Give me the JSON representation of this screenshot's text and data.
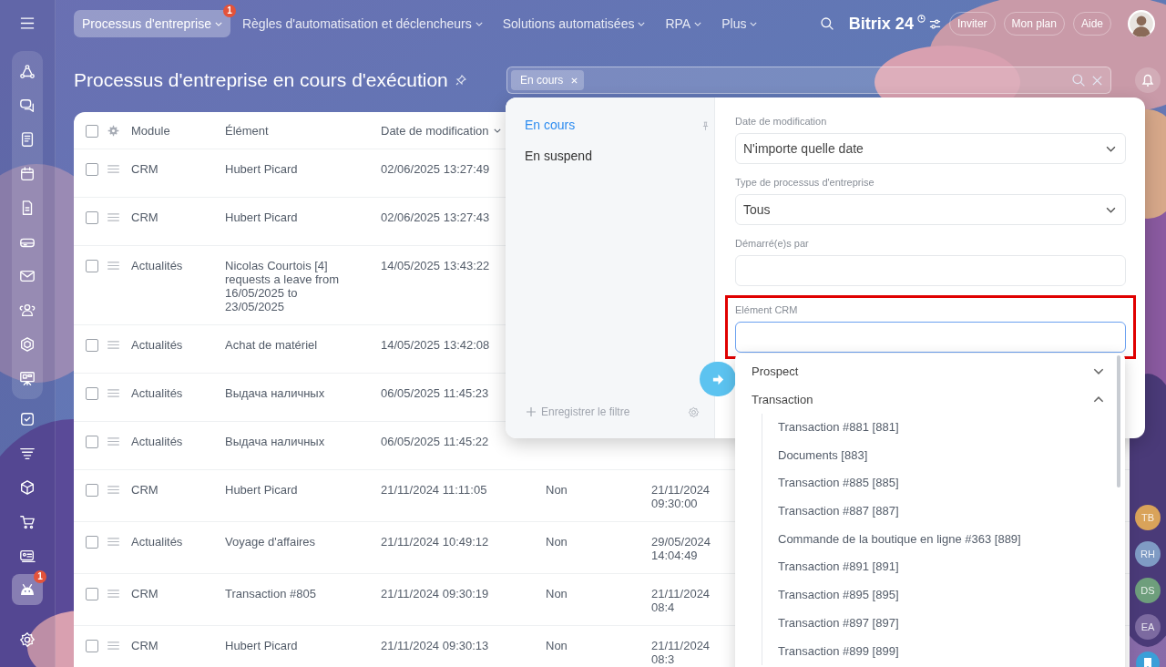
{
  "top_nav": {
    "tabs": [
      {
        "label": "Processus d'entreprise",
        "selected": true,
        "badge": "1"
      },
      {
        "label": "Règles d'automatisation et déclencheurs",
        "selected": false
      },
      {
        "label": "Solutions automatisées",
        "selected": false
      },
      {
        "label": "RPA",
        "selected": false
      },
      {
        "label": "Plus",
        "selected": false
      }
    ],
    "logo": "Bitrix 24",
    "buttons": [
      "Inviter",
      "Mon plan",
      "Aide"
    ]
  },
  "sidebar": {
    "pinned": [
      {
        "kind": "flow",
        "selected": false
      },
      {
        "kind": "chat",
        "selected": false
      },
      {
        "kind": "news",
        "selected": false
      },
      {
        "kind": "calendar",
        "selected": false
      },
      {
        "kind": "document",
        "selected": false
      },
      {
        "kind": "drive",
        "selected": false
      },
      {
        "kind": "mail",
        "selected": false
      },
      {
        "kind": "contacts",
        "selected": false
      },
      {
        "kind": "hexagon",
        "selected": false
      },
      {
        "kind": "board",
        "selected": false
      }
    ],
    "items": [
      {
        "kind": "task",
        "selected": false
      },
      {
        "kind": "funnel",
        "selected": false
      },
      {
        "kind": "box",
        "selected": false
      },
      {
        "kind": "cart",
        "selected": false
      },
      {
        "kind": "card",
        "selected": false
      },
      {
        "kind": "robot",
        "selected": true,
        "badge": "1"
      }
    ]
  },
  "page": {
    "title": "Processus d'entreprise en cours d'exécution"
  },
  "filter_bar": {
    "chips": [
      "En cours"
    ]
  },
  "table": {
    "all_checked": false,
    "columns": [
      "Module",
      "Élément",
      "Date de modification"
    ],
    "rows": [
      {
        "checked": false,
        "module": "CRM",
        "element": "Hubert Picard",
        "date": "02/06/2025 13:27:49"
      },
      {
        "checked": false,
        "module": "CRM",
        "element": "Hubert Picard",
        "date": "02/06/2025 13:27:43"
      },
      {
        "checked": false,
        "module": "Actualités",
        "element": "Nicolas Courtois [4] requests a leave from 16/05/2025 to 23/05/2025",
        "date": "14/05/2025 13:43:22"
      },
      {
        "checked": false,
        "module": "Actualités",
        "element": "Achat de matériel",
        "date": "14/05/2025 13:42:08"
      },
      {
        "checked": false,
        "module": "Actualités",
        "element": "Выдача наличных",
        "date": "06/05/2025 11:45:23"
      },
      {
        "checked": false,
        "module": "Actualités",
        "element": "Выдача наличных",
        "date": "06/05/2025 11:45:22"
      },
      {
        "checked": false,
        "module": "CRM",
        "element": "Hubert Picard",
        "date": "21/11/2024 11:11:05",
        "column_4": "Non",
        "column_5": "21/11/2024 09:30:00"
      },
      {
        "checked": false,
        "module": "Actualités",
        "element": "Voyage d'affaires",
        "date": "21/11/2024 10:49:12",
        "column_4": "Non",
        "column_5": "29/05/2024 14:04:49"
      },
      {
        "checked": false,
        "module": "CRM",
        "element": "Transaction #805",
        "date": "21/11/2024 09:30:19",
        "column_4": "Non",
        "column_5": "21/11/2024 08:4"
      },
      {
        "checked": false,
        "module": "CRM",
        "element": "Hubert Picard",
        "date": "21/11/2024 09:30:13",
        "column_4": "Non",
        "column_5": "21/11/2024 08:3"
      }
    ]
  },
  "filter_popup": {
    "presets": [
      {
        "label": "En cours",
        "selected": true
      },
      {
        "label": "En suspend",
        "selected": false
      }
    ],
    "save_label": "Enregistrer le filtre",
    "fields": [
      {
        "label": "Date de modification",
        "kind": "select",
        "value": "N'importe quelle date",
        "focused": false,
        "highlighted": false
      },
      {
        "label": "Type de processus d'entreprise",
        "kind": "select",
        "value": "Tous",
        "focused": false,
        "highlighted": false
      },
      {
        "label": "Démarré(e)s par",
        "kind": "input",
        "focused": false,
        "highlighted": false
      },
      {
        "label": "Elément CRM",
        "kind": "input",
        "focused": true,
        "highlighted": true
      }
    ]
  },
  "crm_dropdown": {
    "groups": [
      {
        "label": "Prospect",
        "expanded": false
      },
      {
        "label": "Transaction",
        "expanded": true,
        "children": [
          "Transaction #881 [881]",
          "Documents [883]",
          "Transaction #885 [885]",
          "Transaction #887 [887]",
          "Commande de la boutique en ligne #363 [889]",
          "Transaction #891 [891]",
          "Transaction #895 [895]",
          "Transaction #897 [897]",
          "Transaction #899 [899]"
        ]
      }
    ]
  },
  "right_panel": {
    "avatars": [
      {
        "initials": "TB",
        "color": "#d9a35a"
      },
      {
        "initials": "RH",
        "color": "#7f9bc4"
      },
      {
        "initials": "DS",
        "color": "#6e9e7c"
      },
      {
        "initials": "EA",
        "color": "#7c6aa0"
      }
    ]
  }
}
